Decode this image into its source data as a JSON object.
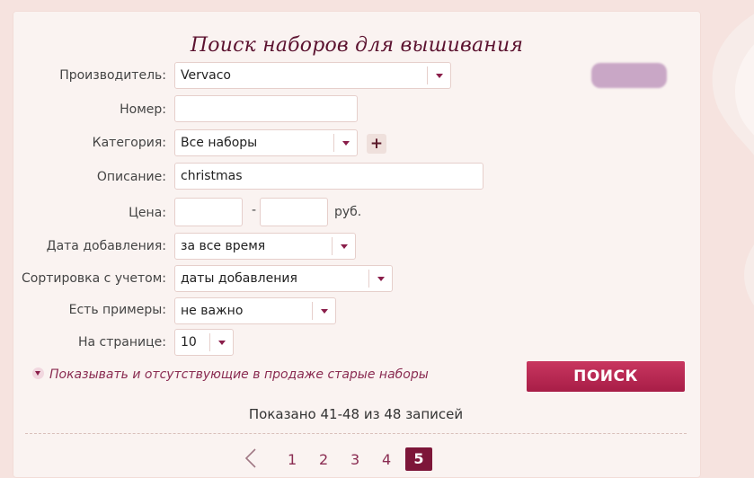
{
  "title": "Поиск наборов для вышивания",
  "form": {
    "manufacturer": {
      "label": "Производитель:",
      "value": "Vervaco"
    },
    "number": {
      "label": "Номер:",
      "value": ""
    },
    "category": {
      "label": "Категория:",
      "value": "Все наборы",
      "add_symbol": "+"
    },
    "description": {
      "label": "Описание:",
      "value": "christmas"
    },
    "price": {
      "label": "Цена:",
      "from": "",
      "to": "",
      "separator": "-",
      "currency": "руб."
    },
    "date_added": {
      "label": "Дата добавления:",
      "value": "за все время"
    },
    "sort_by": {
      "label": "Сортировка с учетом:",
      "value": "даты добавления"
    },
    "has_examples": {
      "label": "Есть примеры:",
      "value": "не важно"
    },
    "per_page": {
      "label": "На странице:",
      "value": "10"
    }
  },
  "toggle_old_sets": "Показывать и отсутствующие в продаже старые наборы",
  "search_button": "ПОИСК",
  "results_summary": "Показано 41-48 из 48 записей",
  "pagination": {
    "pages": [
      "1",
      "2",
      "3",
      "4"
    ],
    "current": "5"
  },
  "colors": {
    "accent": "#a81d47",
    "title": "#5c1330",
    "link": "#8a2c52"
  },
  "icons": [
    "chevron-left-icon",
    "chevron-down-icon",
    "plus-icon"
  ]
}
